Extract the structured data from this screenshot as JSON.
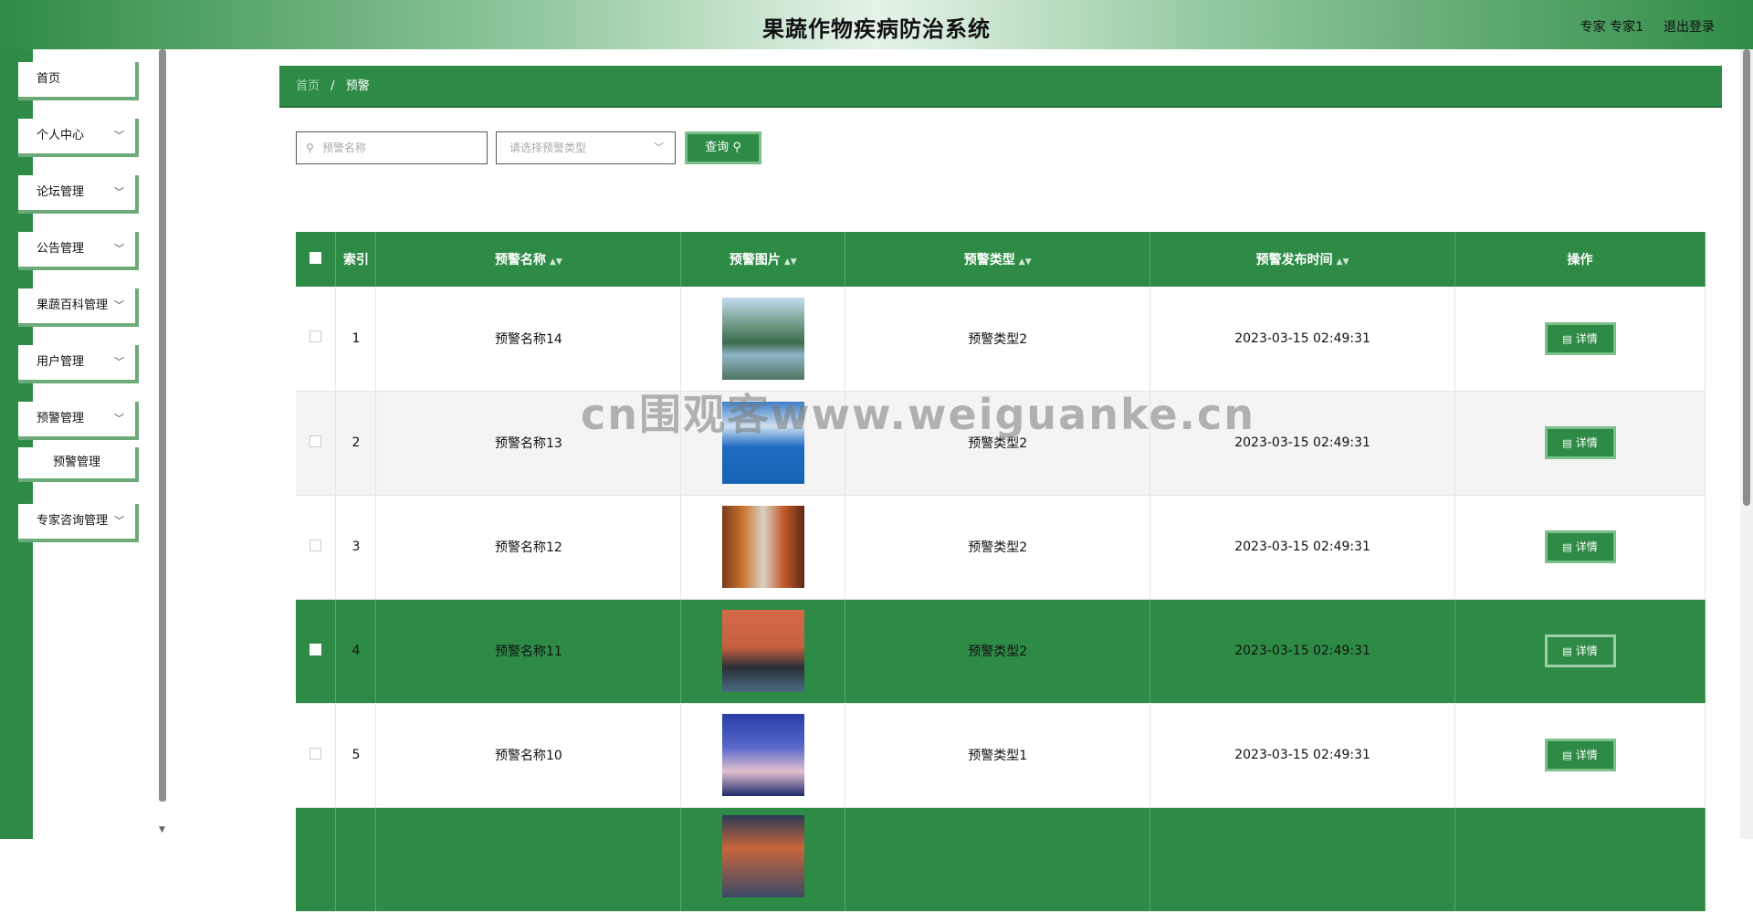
{
  "header": {
    "title": "果蔬作物疾病防治系统",
    "user": "专家 专家1",
    "logout": "退出登录"
  },
  "sidebar": {
    "items": [
      {
        "label": "首页",
        "has_children": false
      },
      {
        "label": "个人中心",
        "has_children": true
      },
      {
        "label": "论坛管理",
        "has_children": true
      },
      {
        "label": "公告管理",
        "has_children": true
      },
      {
        "label": "果蔬百科管理",
        "has_children": true
      },
      {
        "label": "用户管理",
        "has_children": true
      },
      {
        "label": "预警管理",
        "has_children": true,
        "expanded": true,
        "children": [
          "预警管理"
        ]
      },
      {
        "label": "专家咨询管理",
        "has_children": true
      }
    ]
  },
  "breadcrumb": {
    "home": "首页",
    "separator": "/",
    "current": "预警"
  },
  "search": {
    "name_placeholder": "预警名称",
    "type_placeholder": "请选择预警类型",
    "query_label": "查询"
  },
  "table": {
    "columns": [
      "索引",
      "预警名称",
      "预警图片",
      "预警类型",
      "预警发布时间",
      "操作"
    ],
    "detail_label": "详情",
    "rows": [
      {
        "index": "1",
        "name": "预警名称14",
        "type": "预警类型2",
        "time": "2023-03-15 02:49:31",
        "style": "white"
      },
      {
        "index": "2",
        "name": "预警名称13",
        "type": "预警类型2",
        "time": "2023-03-15 02:49:31",
        "style": "grey"
      },
      {
        "index": "3",
        "name": "预警名称12",
        "type": "预警类型2",
        "time": "2023-03-15 02:49:31",
        "style": "white"
      },
      {
        "index": "4",
        "name": "预警名称11",
        "type": "预警类型2",
        "time": "2023-03-15 02:49:31",
        "style": "green"
      },
      {
        "index": "5",
        "name": "预警名称10",
        "type": "预警类型1",
        "time": "2023-03-15 02:49:31",
        "style": "white"
      },
      {
        "index": "",
        "name": "",
        "type": "",
        "time": "",
        "style": "green"
      }
    ]
  },
  "watermark": "cn围观客www.weiguanke.cn",
  "colors": {
    "primary": "#2e8b46",
    "accent_border": "#7cc08b",
    "sidebar_border": "#6cab79"
  }
}
